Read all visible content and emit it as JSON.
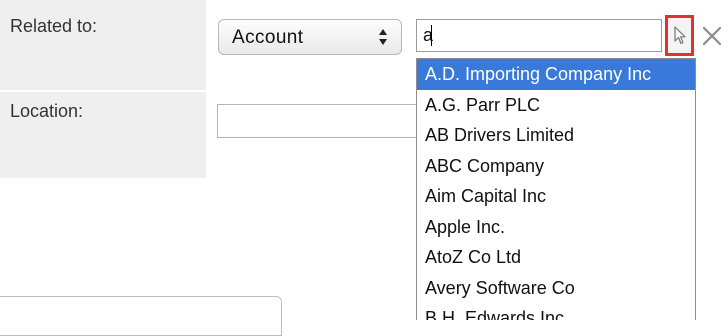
{
  "form": {
    "related_to_label": "Related to:",
    "location_label": "Location:",
    "related_module": {
      "selected": "Account",
      "icon": "updown-arrows-icon"
    },
    "related_record": {
      "value": "a",
      "placeholder": ""
    },
    "select_button_icon": "cursor-arrow-icon",
    "clear_button_icon": "close-x-icon",
    "location": {
      "value": "",
      "placeholder": ""
    }
  },
  "autocomplete": {
    "selected_index": 0,
    "options": [
      "A.D. Importing Company Inc",
      "A.G. Parr PLC",
      "AB Drivers Limited",
      "ABC Company",
      "Aim Capital Inc",
      "Apple Inc.",
      "AtoZ Co Ltd",
      "Avery Software Co",
      "B.H. Edwards Inc"
    ]
  },
  "colors": {
    "label_bg": "#efefef",
    "highlight": "#3879d9",
    "focus_outline": "#e0342a"
  }
}
